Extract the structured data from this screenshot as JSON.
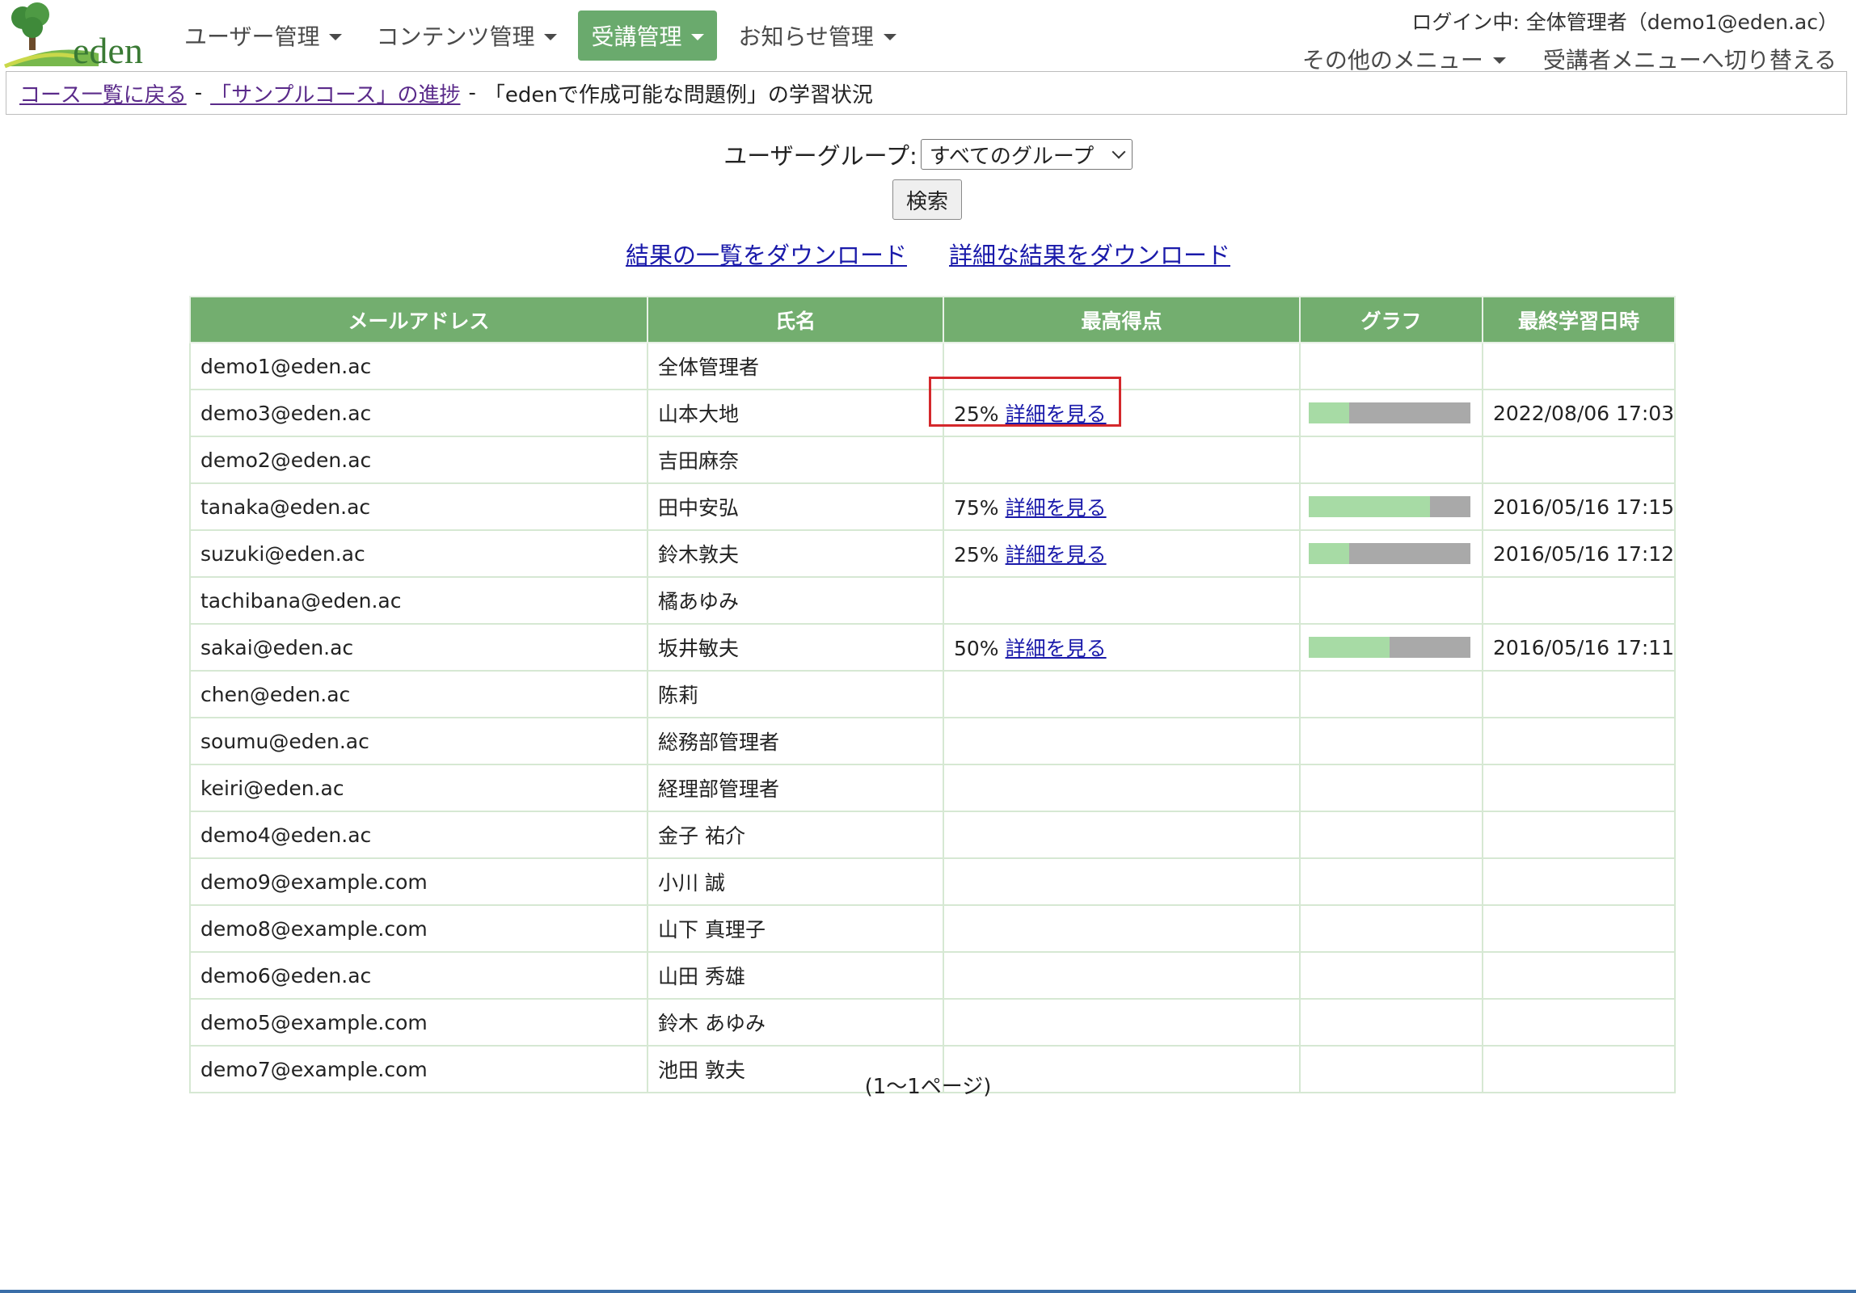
{
  "header": {
    "logo_text": "eden",
    "nav": [
      {
        "label": "ユーザー管理",
        "active": false
      },
      {
        "label": "コンテンツ管理",
        "active": false
      },
      {
        "label": "受講管理",
        "active": true
      },
      {
        "label": "お知らせ管理",
        "active": false
      }
    ],
    "login_text": "ログイン中: 全体管理者（demo1@eden.ac）",
    "other_menu": "その他のメニュー",
    "switch_menu": "受講者メニューへ切り替える"
  },
  "breadcrumb": {
    "back_link": "コース一覧に戻る",
    "sep": "-",
    "course_link": "「サンプルコース」の進捗",
    "current": "「edenで作成可能な問題例」の学習状況"
  },
  "search": {
    "label": "ユーザーグループ:",
    "group_value": "すべてのグループ",
    "button": "検索"
  },
  "downloads": {
    "summary": "結果の一覧をダウンロード",
    "detail": "詳細な結果をダウンロード"
  },
  "table": {
    "headers": [
      "メールアドレス",
      "氏名",
      "最高得点",
      "グラフ",
      "最終学習日時"
    ],
    "detail_link": "詳細を見る",
    "rows": [
      {
        "email": "demo1@eden.ac",
        "name": "全体管理者",
        "score": "",
        "progress": null,
        "date": ""
      },
      {
        "email": "demo3@eden.ac",
        "name": "山本大地",
        "score": "25%",
        "progress": 0.25,
        "date": "2022/08/06 17:03"
      },
      {
        "email": "demo2@eden.ac",
        "name": "吉田麻奈",
        "score": "",
        "progress": null,
        "date": ""
      },
      {
        "email": "tanaka@eden.ac",
        "name": "田中安弘",
        "score": "75%",
        "progress": 0.75,
        "date": "2016/05/16 17:15"
      },
      {
        "email": "suzuki@eden.ac",
        "name": "鈴木敦夫",
        "score": "25%",
        "progress": 0.25,
        "date": "2016/05/16 17:12"
      },
      {
        "email": "tachibana@eden.ac",
        "name": "橘あゆみ",
        "score": "",
        "progress": null,
        "date": ""
      },
      {
        "email": "sakai@eden.ac",
        "name": "坂井敏夫",
        "score": "50%",
        "progress": 0.5,
        "date": "2016/05/16 17:11"
      },
      {
        "email": "chen@eden.ac",
        "name": "陈莉",
        "score": "",
        "progress": null,
        "date": ""
      },
      {
        "email": "soumu@eden.ac",
        "name": "総務部管理者",
        "score": "",
        "progress": null,
        "date": ""
      },
      {
        "email": "keiri@eden.ac",
        "name": "経理部管理者",
        "score": "",
        "progress": null,
        "date": ""
      },
      {
        "email": "demo4@eden.ac",
        "name": "金子 祐介",
        "score": "",
        "progress": null,
        "date": ""
      },
      {
        "email": "demo9@example.com",
        "name": "小川 誠",
        "score": "",
        "progress": null,
        "date": ""
      },
      {
        "email": "demo8@example.com",
        "name": "山下 真理子",
        "score": "",
        "progress": null,
        "date": ""
      },
      {
        "email": "demo6@eden.ac",
        "name": "山田 秀雄",
        "score": "",
        "progress": null,
        "date": ""
      },
      {
        "email": "demo5@example.com",
        "name": "鈴木 あゆみ",
        "score": "",
        "progress": null,
        "date": ""
      },
      {
        "email": "demo7@example.com",
        "name": "池田 敦夫",
        "score": "",
        "progress": null,
        "date": ""
      }
    ]
  },
  "pager": "(1～1ページ)",
  "colors": {
    "accent_green": "#73ae6f",
    "bar_fill": "#a7dba5",
    "bar_rest": "#a9a9a9",
    "highlight": "#d4282c"
  }
}
